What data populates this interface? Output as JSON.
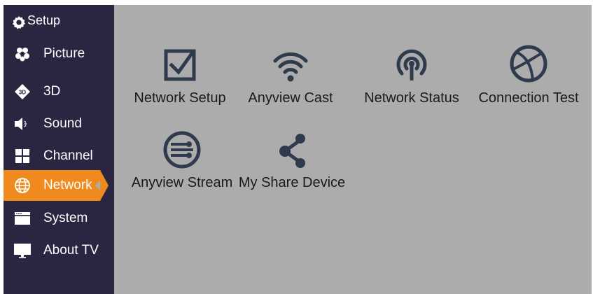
{
  "sidebar": {
    "header": {
      "icon": "gear-icon",
      "label": "Setup"
    },
    "items": [
      {
        "icon": "picture-icon",
        "label": "Picture",
        "active": false
      },
      {
        "icon": "3d-icon",
        "label": "3D",
        "active": false
      },
      {
        "icon": "speaker-icon",
        "label": "Sound",
        "active": false
      },
      {
        "icon": "grid-icon",
        "label": "Channel",
        "active": false
      },
      {
        "icon": "globe-icon",
        "label": "Network",
        "active": true
      },
      {
        "icon": "system-window-icon",
        "label": "System",
        "active": false
      },
      {
        "icon": "monitor-icon",
        "label": "About TV",
        "active": false
      }
    ]
  },
  "colors": {
    "sidebar_bg": "#2a2642",
    "content_bg": "#acacac",
    "active_accent": "#f08a1e",
    "icon_dark": "#2f3b4c"
  },
  "network_tiles": [
    {
      "icon": "checkbox-icon",
      "label": "Network Setup"
    },
    {
      "icon": "wifi-icon",
      "label": "Anyview Cast"
    },
    {
      "icon": "antenna-icon",
      "label": "Network Status"
    },
    {
      "icon": "globe-icon",
      "label": "Connection Test"
    },
    {
      "icon": "stream-icon",
      "label": "Anyview Stream"
    },
    {
      "icon": "share-icon",
      "label": "My Share Device"
    }
  ]
}
